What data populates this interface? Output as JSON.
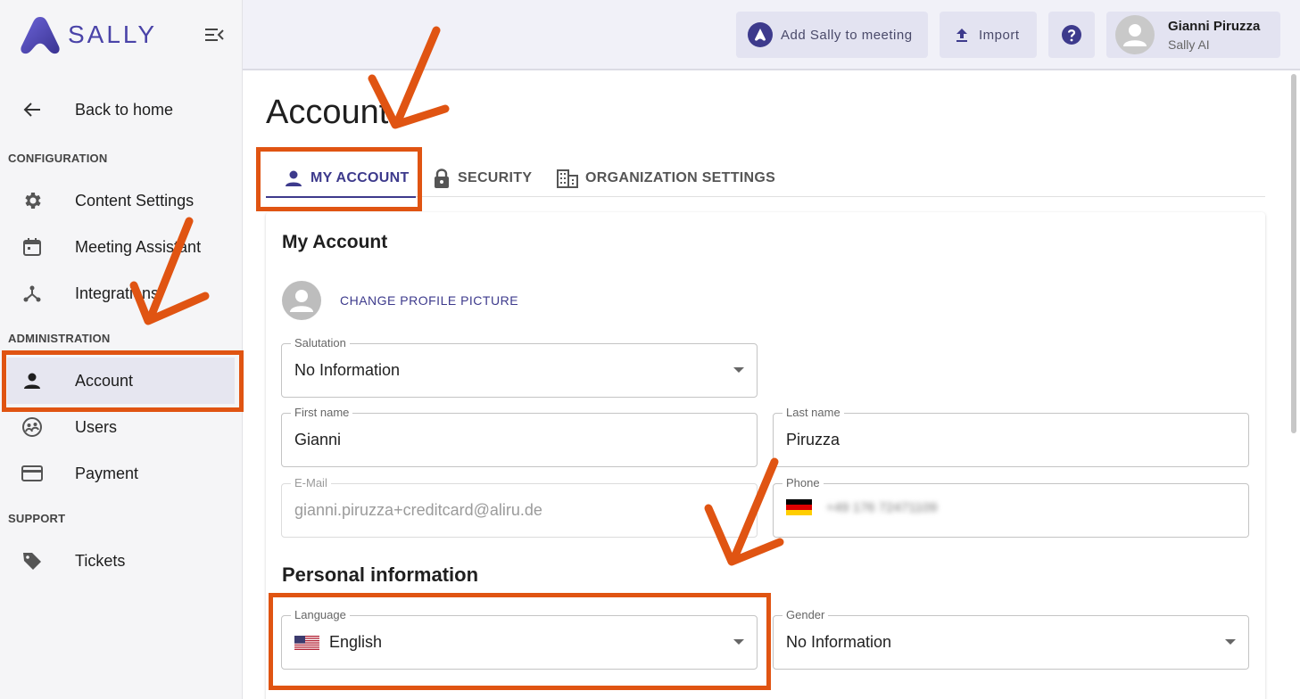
{
  "brand": {
    "name": "SALLY",
    "color": "#4a43a8"
  },
  "sidebar": {
    "back": "Back to home",
    "sections": {
      "configuration": "CONFIGURATION",
      "administration": "ADMINISTRATION",
      "support": "SUPPORT"
    },
    "items": [
      {
        "label": "Content Settings",
        "icon": "gear-icon"
      },
      {
        "label": "Meeting Assistant",
        "icon": "calendar-icon"
      },
      {
        "label": "Integrations",
        "icon": "integrations-icon"
      },
      {
        "label": "Account",
        "icon": "person-icon",
        "active": true
      },
      {
        "label": "Users",
        "icon": "users-icon"
      },
      {
        "label": "Payment",
        "icon": "credit-card-icon"
      },
      {
        "label": "Tickets",
        "icon": "tag-icon"
      }
    ]
  },
  "topbar": {
    "add_sally": "Add Sally to meeting",
    "import": "Import",
    "help_icon": "help-icon",
    "user": {
      "name": "Gianni Piruzza",
      "org": "Sally AI"
    }
  },
  "page": {
    "title": "Account",
    "tabs": [
      {
        "label": "MY ACCOUNT",
        "icon": "person-icon",
        "active": true
      },
      {
        "label": "SECURITY",
        "icon": "lock-icon"
      },
      {
        "label": "ORGANIZATION SETTINGS",
        "icon": "building-icon"
      }
    ]
  },
  "my_account": {
    "title": "My Account",
    "change_picture": "CHANGE PROFILE PICTURE",
    "salutation": {
      "label": "Salutation",
      "value": "No Information"
    },
    "first_name": {
      "label": "First name",
      "value": "Gianni"
    },
    "last_name": {
      "label": "Last name",
      "value": "Piruzza"
    },
    "email": {
      "label": "E-Mail",
      "value": "gianni.piruzza+creditcard@aliru.de"
    },
    "phone": {
      "label": "Phone",
      "value": "+49 176 72471109",
      "flag": "germany-flag-icon"
    }
  },
  "personal": {
    "title": "Personal information",
    "language": {
      "label": "Language",
      "value": "English",
      "flag": "us-flag-icon"
    },
    "gender": {
      "label": "Gender",
      "value": "No Information"
    }
  },
  "annotation_color": "#e05412"
}
